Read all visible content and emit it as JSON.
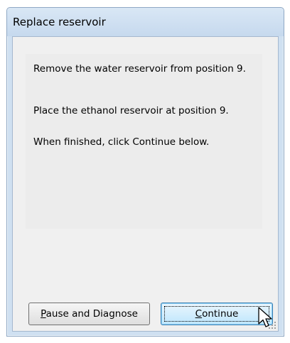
{
  "dialog": {
    "title": "Replace reservoir",
    "messages": [
      "Remove the water reservoir from position 9.",
      "Place the ethanol reservoir at position 9.",
      "When finished, click Continue below."
    ],
    "buttons": {
      "pause_mnemonic": "P",
      "pause_rest": "ause and Diagnose",
      "continue_mnemonic": "C",
      "continue_rest": "ontinue"
    }
  },
  "icons": {
    "cursor": "arrow-cursor-icon",
    "size_grip": "size-grip-icon"
  },
  "colors": {
    "title_bar": "#cfe0f1",
    "client_background": "#f0f0f0",
    "message_panel": "#ececec",
    "default_button_border": "#3c7fb1"
  }
}
